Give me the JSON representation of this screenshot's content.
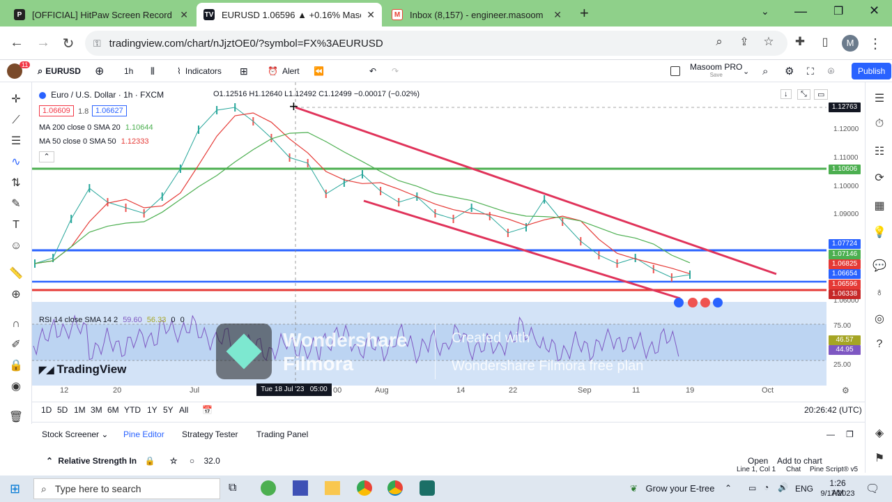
{
  "browser": {
    "tabs": [
      {
        "title": "[OFFICIAL] HitPaw Screen Record",
        "icon": "hitpaw-icon"
      },
      {
        "title": "EURUSD 1.06596 ▲ +0.16% Maso",
        "icon": "tradingview-icon"
      },
      {
        "title": "Inbox (8,157) - engineer.masoom",
        "icon": "gmail-icon"
      }
    ],
    "url": "tradingview.com/chart/nJjztOE0/?symbol=FX%3AEURUSD"
  },
  "toolbar": {
    "notif_count": "11",
    "symbol": "EURUSD",
    "interval": "1h",
    "indicators": "Indicators",
    "alert": "Alert",
    "user_name": "Masoom PRO",
    "user_sub": "Save",
    "publish": "Publish"
  },
  "legend": {
    "pair": "Euro / U.S. Dollar · 1h · FXCM",
    "ohlc": "O1.12516 H1.12640 L1.12492 C1.12499 −0.00017 (−0.02%)",
    "sell": "1.06609",
    "spread": "1.8",
    "buy": "1.06627",
    "ma200": "MA 200 close 0 SMA 20",
    "ma200_val": "1.10644",
    "ma50": "MA 50 close 0 SMA 50",
    "ma50_val": "1.12333",
    "rsi": "RSI 14 close SMA 14 2",
    "rsi_val1": "59.60",
    "rsi_val2": "56.33",
    "rsi_val3": "0",
    "rsi_val4": "0"
  },
  "price_axis": {
    "labels": [
      "1.12000",
      "1.11000",
      "1.10000",
      "1.09000",
      "1.06000"
    ],
    "cursor_price": "1.12763",
    "tags": [
      {
        "v": "1.10606",
        "c": "#4caf50"
      },
      {
        "v": "1.07724",
        "c": "#2962ff"
      },
      {
        "v": "1.07146",
        "c": "#4caf50"
      },
      {
        "v": "1.06825",
        "c": "#e53935"
      },
      {
        "v": "1.06654",
        "c": "#2962ff"
      },
      {
        "v": "1.06596",
        "c": "#e53935"
      },
      {
        "v": "1.06338",
        "c": "#c62828"
      }
    ],
    "rsi_labels": [
      "75.00",
      "25.00"
    ],
    "rsi_tags": [
      {
        "v": "46.57",
        "c": "#a5a524"
      },
      {
        "v": "44.95",
        "c": "#7e57c2"
      }
    ]
  },
  "time_axis": {
    "labels": [
      "12",
      "20",
      "Jul",
      "Aug",
      "14",
      "22",
      "Sep",
      "11",
      "19",
      "Oct"
    ],
    "cursor_time": "Tue 18 Jul '23   05:00",
    "cursor_tail": "00"
  },
  "range": {
    "buttons": [
      "1D",
      "5D",
      "1M",
      "3M",
      "6M",
      "YTD",
      "1Y",
      "5Y",
      "All"
    ],
    "clock": "20:26:42 (UTC)"
  },
  "bottom": {
    "tabs": [
      "Stock Screener",
      "Pine Editor",
      "Strategy Tester",
      "Trading Panel"
    ],
    "script_name": "Relative Strength In",
    "version": "32.0",
    "open": "Open",
    "add": "Add to chart",
    "status": [
      "Line 1, Col 1",
      "Chat",
      "Pine Script® v5"
    ]
  },
  "watermark": {
    "brand1": "Wondershare",
    "brand2": "Filmora",
    "created": "Created with",
    "plan": "Wondershare Filmora free plan",
    "tv": "TradingView"
  },
  "taskbar": {
    "search": "Type here to search",
    "weather": "Grow your E-tree",
    "lang": "ENG",
    "time": "1:26 AM",
    "date": "9/17/2023"
  },
  "chart_data": {
    "type": "line",
    "series": [
      {
        "values": [
          1.07,
          1.072,
          1.086,
          1.097,
          1.092,
          1.09,
          1.088,
          1.094,
          1.104,
          1.118,
          1.125,
          1.126,
          1.121,
          1.115,
          1.108,
          1.106,
          1.095,
          1.099,
          1.102,
          1.096,
          1.092,
          1.094,
          1.088,
          1.086,
          1.09,
          1.087,
          1.081,
          1.083,
          1.093,
          1.085,
          1.078,
          1.073,
          1.07,
          1.072,
          1.068,
          1.065,
          1.066
        ]
      }
    ],
    "ylim": [
      1.06,
      1.13
    ]
  }
}
